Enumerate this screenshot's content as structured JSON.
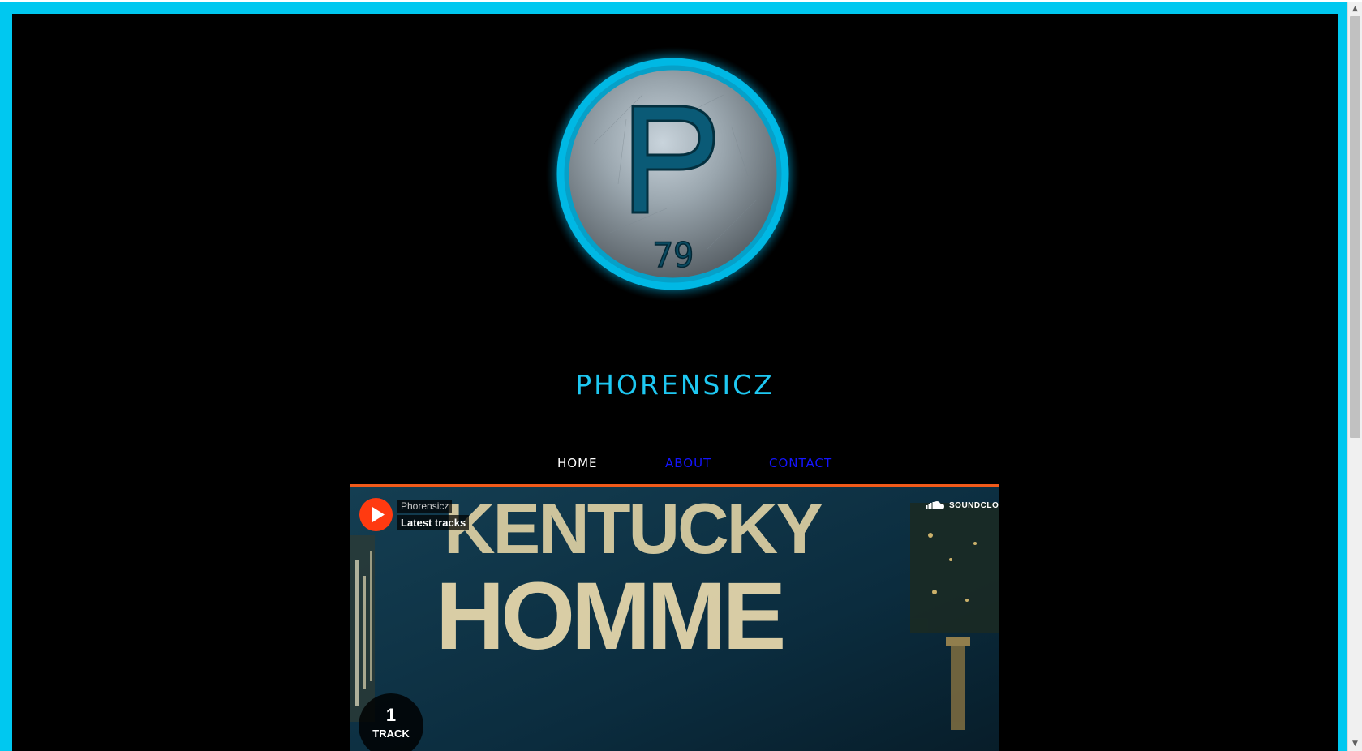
{
  "site": {
    "title": "PHORENSICZ",
    "logo_text": "79",
    "logo_letter": "P"
  },
  "nav": {
    "items": [
      {
        "label": "HOME",
        "active": true
      },
      {
        "label": "ABOUT",
        "active": false
      },
      {
        "label": "CONTACT",
        "active": false
      }
    ]
  },
  "player": {
    "artist": "Phorensicz",
    "playlist": "Latest tracks",
    "brand": "SOUNDCLOUD",
    "track_count": "1",
    "track_count_label": "TRACK",
    "artwork_text": [
      "KENTUCKY",
      "HOMME"
    ]
  },
  "colors": {
    "frame": "#00c8f0",
    "accent": "#1ec8f2",
    "nav_link": "#1414ff",
    "player_accent": "#f05a1a"
  },
  "icons": {
    "play": "play-icon",
    "soundcloud": "soundcloud-cloud-icon"
  }
}
